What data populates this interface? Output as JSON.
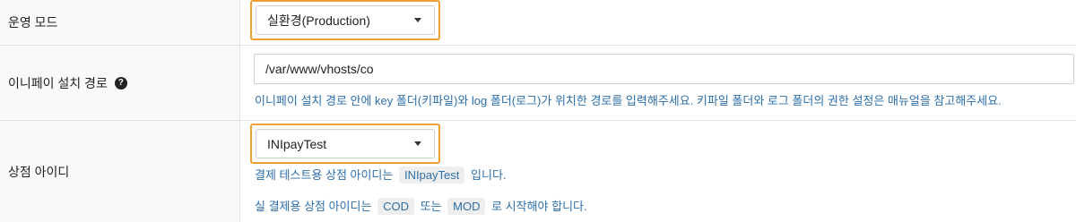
{
  "rows": {
    "mode": {
      "label": "운영 모드",
      "select_value": "실환경(Production)"
    },
    "path": {
      "label": "이니페이 설치 경로",
      "help_icon": "question-circle-icon",
      "input_value": "/var/www/vhosts/co",
      "help_text": "이니페이 설치 경로 안에 key 폴더(키파일)와 log 폴더(로그)가 위치한 경로를 입력해주세요. 키파일 폴더와 로그 폴더의 권한 설정은 매뉴얼을 참고해주세요."
    },
    "store_id": {
      "label": "상점 아이디",
      "select_value": "INIpayTest",
      "help1_before": "결제 테스트용 상점 아이디는",
      "help1_code": "INIpayTest",
      "help1_after": "입니다.",
      "help2_before": "실 결제용 상점 아이디는",
      "help2_code1": "COD",
      "help2_mid": "또는",
      "help2_code2": "MOD",
      "help2_after": "로 시작해야 합니다."
    }
  },
  "colors": {
    "highlight": "#f0a030",
    "help_text": "#2e6fa8",
    "label_bg": "#f9f9f9"
  }
}
